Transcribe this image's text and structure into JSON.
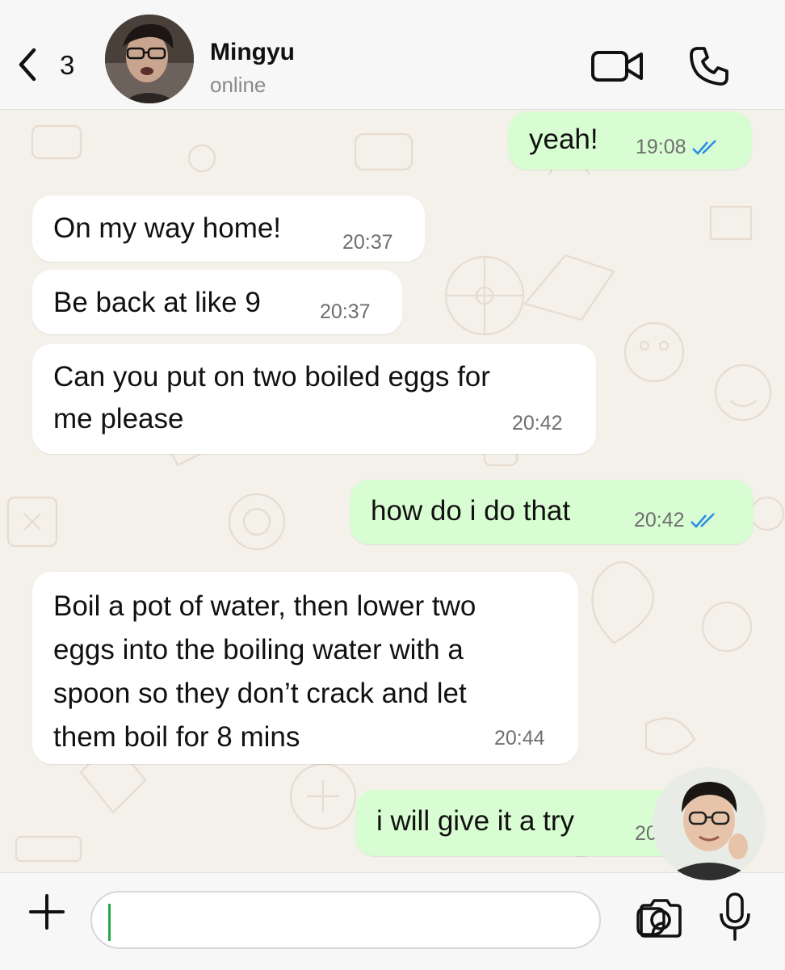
{
  "header": {
    "back_count": "3",
    "contact_name": "Mingyu",
    "contact_status": "online"
  },
  "messages": [
    {
      "direction": "outgoing",
      "text": "yeah!",
      "time": "19:08",
      "read": true
    },
    {
      "direction": "incoming",
      "text": "On my way home!",
      "time": "20:37"
    },
    {
      "direction": "incoming",
      "text": "Be back at like 9",
      "time": "20:37"
    },
    {
      "direction": "incoming",
      "lines": [
        "Can you put on two boiled eggs for",
        "me please"
      ],
      "time": "20:42"
    },
    {
      "direction": "outgoing",
      "text": "how do i do that",
      "time": "20:42",
      "read": true
    },
    {
      "direction": "incoming",
      "lines": [
        "Boil a pot of water, then lower two",
        "eggs into the boiling water with a",
        "spoon so they don’t crack and let",
        "them boil for 8 mins"
      ],
      "time": "20:44"
    },
    {
      "direction": "outgoing",
      "text": "i will give it a try",
      "time": "20:44",
      "read": true
    }
  ],
  "composer": {
    "value": "",
    "placeholder": ""
  },
  "icons": {
    "back": "chevron-left-icon",
    "video": "video-camera-icon",
    "call": "phone-icon",
    "plus": "plus-icon",
    "sticker": "sticker-icon",
    "camera": "camera-icon",
    "mic": "microphone-icon",
    "ticks": "double-check-icon"
  },
  "colors": {
    "incoming_bubble": "#ffffff",
    "outgoing_bubble": "#d9fdd3",
    "read_ticks": "#2b8ee6",
    "wallpaper": "#f4f0ea",
    "caret": "#25a84a"
  }
}
